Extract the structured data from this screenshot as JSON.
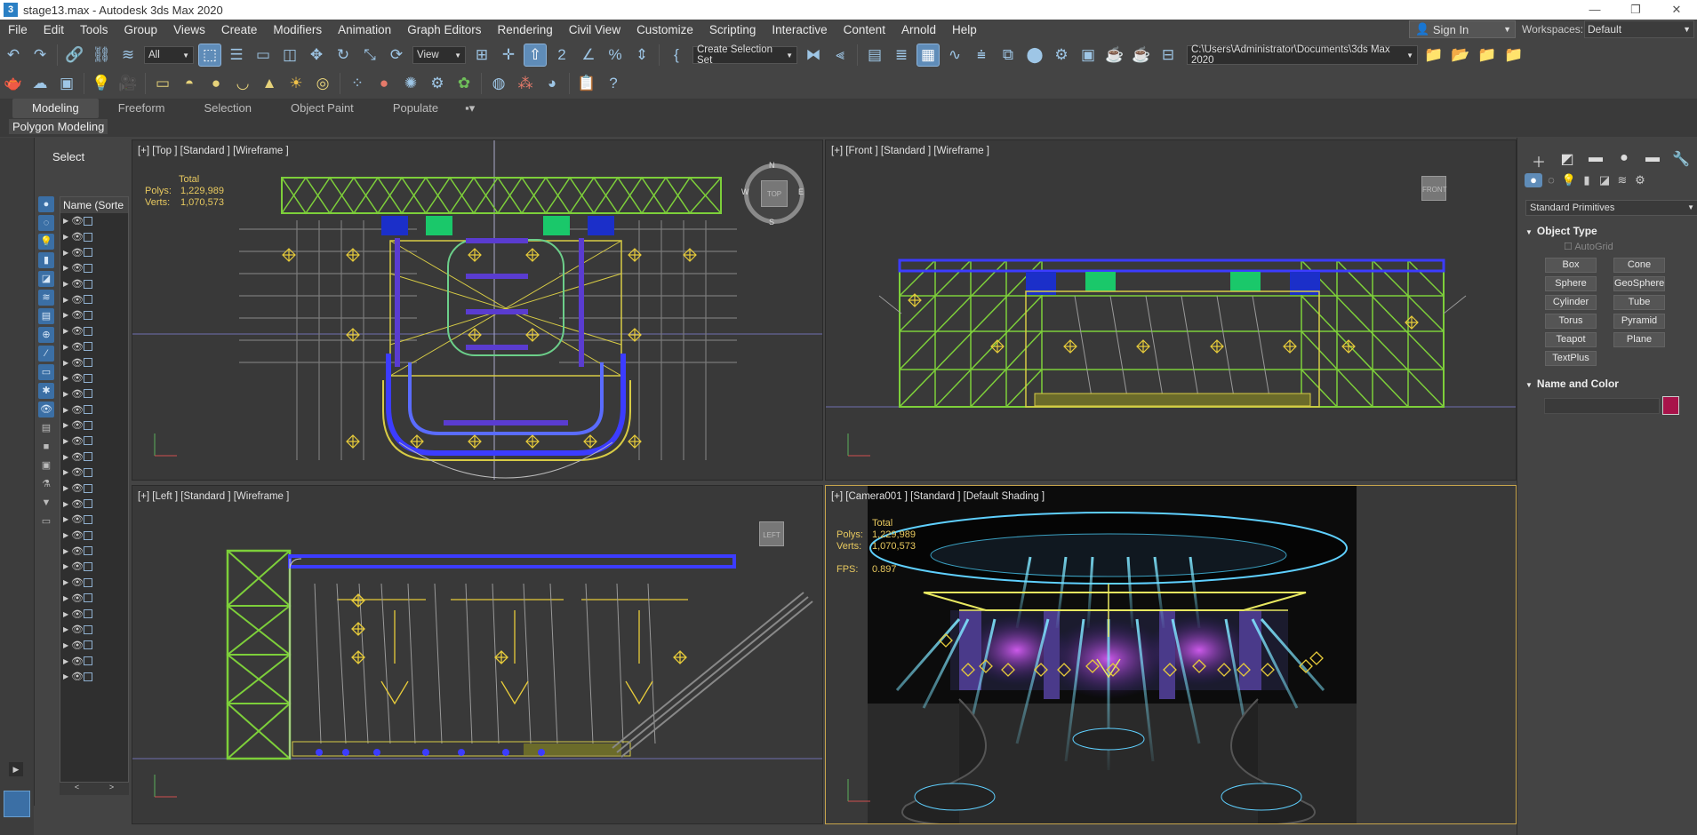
{
  "window": {
    "title": "stage13.max - Autodesk 3ds Max 2020",
    "icon": "3ds-max-icon",
    "controls": [
      "—",
      "❐",
      "✕"
    ]
  },
  "menu": [
    "File",
    "Edit",
    "Tools",
    "Group",
    "Views",
    "Create",
    "Modifiers",
    "Animation",
    "Graph Editors",
    "Rendering",
    "Civil View",
    "Customize",
    "Scripting",
    "Interactive",
    "Content",
    "Arnold",
    "Help"
  ],
  "signin": {
    "label": "Sign In"
  },
  "workspaces": {
    "label": "Workspaces:",
    "value": "Default"
  },
  "toolbar1": {
    "selection_filter": "All",
    "ref_coord": "View",
    "selection_set": "Create Selection Set",
    "project_path": "C:\\Users\\Administrator\\Documents\\3ds Max 2020"
  },
  "ribbon": {
    "tabs": [
      "Modeling",
      "Freeform",
      "Selection",
      "Object Paint",
      "Populate"
    ],
    "active_tab": "Modeling",
    "panel": "Polygon Modeling"
  },
  "scene_explorer": {
    "title": "Select",
    "column": "Name (Sorte",
    "row_count": 30
  },
  "viewports": [
    {
      "id": "top",
      "label": "[+] [Top ] [Standard ] [Wireframe ]",
      "stats": {
        "total": "Total",
        "polys_label": "Polys:",
        "polys": "1,229,989",
        "verts_label": "Verts:",
        "verts": "1,070,573"
      },
      "cube": "TOP"
    },
    {
      "id": "front",
      "label": "[+] [Front ] [Standard ] [Wireframe ]",
      "cube": "FRONT"
    },
    {
      "id": "left",
      "label": "[+] [Left ] [Standard ] [Wireframe ]",
      "cube": "LEFT"
    },
    {
      "id": "camera",
      "label": "[+] [Camera001 ] [Standard ] [Default Shading ]",
      "stats": {
        "total": "Total",
        "polys_label": "Polys:",
        "polys": "1,229,989",
        "verts_label": "Verts:",
        "verts": "1,070,573",
        "fps_label": "FPS:",
        "fps": "0.897"
      }
    }
  ],
  "compass": {
    "n": "N",
    "s": "S",
    "e": "E",
    "w": "W"
  },
  "command_panel": {
    "category": "Standard Primitives",
    "object_type_title": "Object Type",
    "autogrid": "AutoGrid",
    "buttons": [
      "Box",
      "Cone",
      "Sphere",
      "GeoSphere",
      "Cylinder",
      "Tube",
      "Torus",
      "Pyramid",
      "Teapot",
      "Plane",
      "TextPlus"
    ],
    "name_color_title": "Name and Color",
    "color": "#a8134a"
  }
}
